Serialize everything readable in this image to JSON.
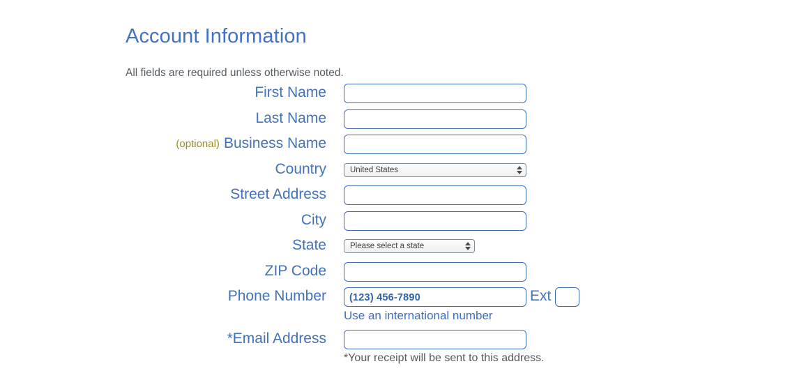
{
  "heading": "Account Information",
  "subnote": "All fields are required unless otherwise noted.",
  "colors": {
    "heading_blue": "#4271c6",
    "label_blue": "#4272b8",
    "border_blue": "#3d6eb0",
    "optional_gold": "#968a27",
    "note_gray": "#555b60",
    "link_blue": "#3b6fc4"
  },
  "fields": {
    "first_name": {
      "label": "First Name",
      "value": "",
      "placeholder": ""
    },
    "last_name": {
      "label": "Last Name",
      "value": "",
      "placeholder": ""
    },
    "business_name": {
      "label": "Business Name",
      "optional_tag": "(optional)",
      "value": "",
      "placeholder": ""
    },
    "country": {
      "label": "Country",
      "selected": "United States"
    },
    "street_address": {
      "label": "Street Address",
      "value": "",
      "placeholder": ""
    },
    "city": {
      "label": "City",
      "value": "",
      "placeholder": ""
    },
    "state": {
      "label": "State",
      "selected": "Please select a state"
    },
    "zip_code": {
      "label": "ZIP Code",
      "value": "",
      "placeholder": ""
    },
    "phone_number": {
      "label": "Phone Number",
      "value": "",
      "placeholder": "(123) 456-7890",
      "ext_label": "Ext",
      "ext_value": "",
      "helper_link": "Use an international number"
    },
    "email_address": {
      "label": "*Email Address",
      "value": "",
      "placeholder": "",
      "footnote": "*Your receipt will be sent to this address."
    }
  }
}
